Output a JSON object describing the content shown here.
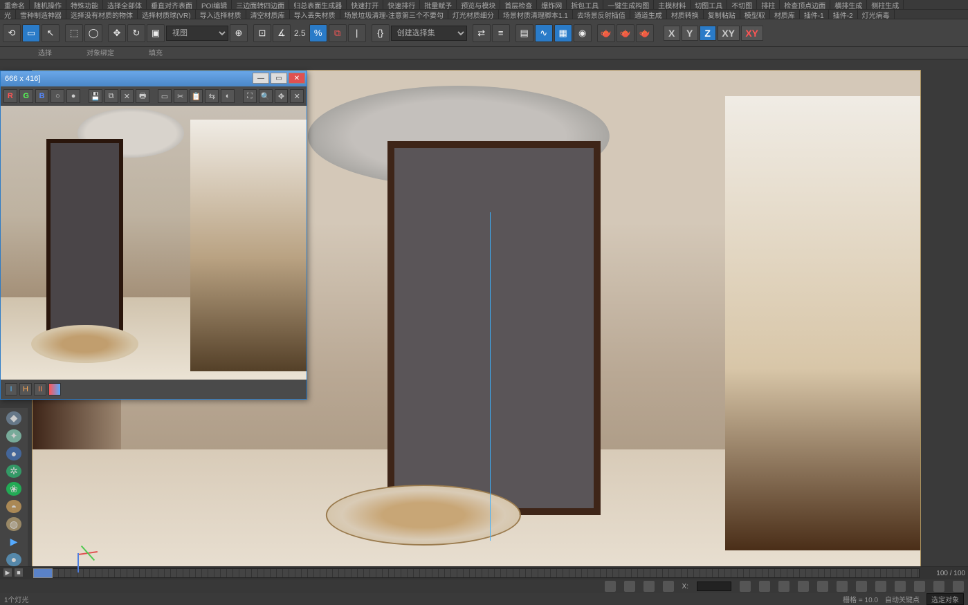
{
  "top_menu_row1": [
    "重命名",
    "随机操作",
    "特殊功能",
    "选择全部体",
    "垂直对齐表面",
    "POI编辑",
    "三边面转四边面",
    "归总表面生成器",
    "快速打开",
    "快速排行",
    "批量赋予",
    "预览与模块",
    "首层检查",
    "爆炸网",
    "拆包工具",
    "一键生成构图",
    "主模材料",
    "切图工具",
    "不切图",
    "排柱",
    "检查顶点边面",
    "横排生成",
    "侧柱生成"
  ],
  "top_menu_row2": [
    "光",
    "雪种制造神器",
    "选择没有材质的物体",
    "选择材质球(VR)",
    "导入选择材质",
    "清空材质库",
    "导入丢失材质",
    "场景垃圾清理-注意第三个不要勾",
    "灯光材质细分",
    "场景材质清理脚本1.1",
    "去场景反射插值",
    "通道生成",
    "材质转换",
    "复制粘贴",
    "模型取",
    "材质库",
    "插件-1",
    "插件-2",
    "灯光病毒"
  ],
  "toolbar": {
    "view_dropdown": "视图",
    "selset_dropdown": "创建选择集",
    "snap_value": "2.5"
  },
  "sub_labels": {
    "a": "选择",
    "b": "对象绑定",
    "c": "填充"
  },
  "axes": {
    "x": "X",
    "y": "Y",
    "z": "Z",
    "xy": "XY",
    "xy2": "XY"
  },
  "render": {
    "title": "666 x 416]",
    "channels": {
      "r": "R",
      "g": "G",
      "b": "B"
    },
    "bottom_letters": [
      "I",
      "H",
      "II"
    ]
  },
  "timeline": {
    "end_label": "100 / 100"
  },
  "status": {
    "objects": "1个灯光",
    "autokey": "自动关键点",
    "coord_x": "X:",
    "coord_label": "栅格 = 10.0",
    "lockfield": "选定对象"
  }
}
